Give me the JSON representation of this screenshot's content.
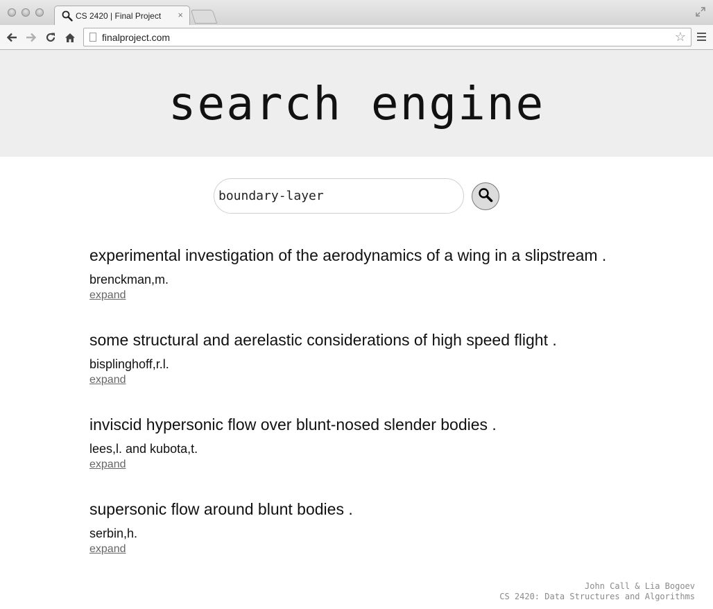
{
  "browser": {
    "tab_title": "CS 2420 | Final Project",
    "tab_close": "×",
    "url": "finalproject.com",
    "star": "☆"
  },
  "header": {
    "title": "search engine"
  },
  "search": {
    "value": "boundary-layer"
  },
  "results": [
    {
      "title": "experimental investigation of the aerodynamics of a wing in a slipstream .",
      "author": "brenckman,m.",
      "expand": "expand"
    },
    {
      "title": "some structural and aerelastic considerations of high speed flight .",
      "author": "bisplinghoff,r.l.",
      "expand": "expand"
    },
    {
      "title": "inviscid hypersonic flow over blunt-nosed slender bodies .",
      "author": "lees,l. and kubota,t.",
      "expand": "expand"
    },
    {
      "title": "supersonic flow around blunt bodies .",
      "author": "serbin,h.",
      "expand": "expand"
    }
  ],
  "footer": {
    "authors": "John Call & Lia Bogoev",
    "course": "CS 2420: Data Structures and Algorithms"
  }
}
